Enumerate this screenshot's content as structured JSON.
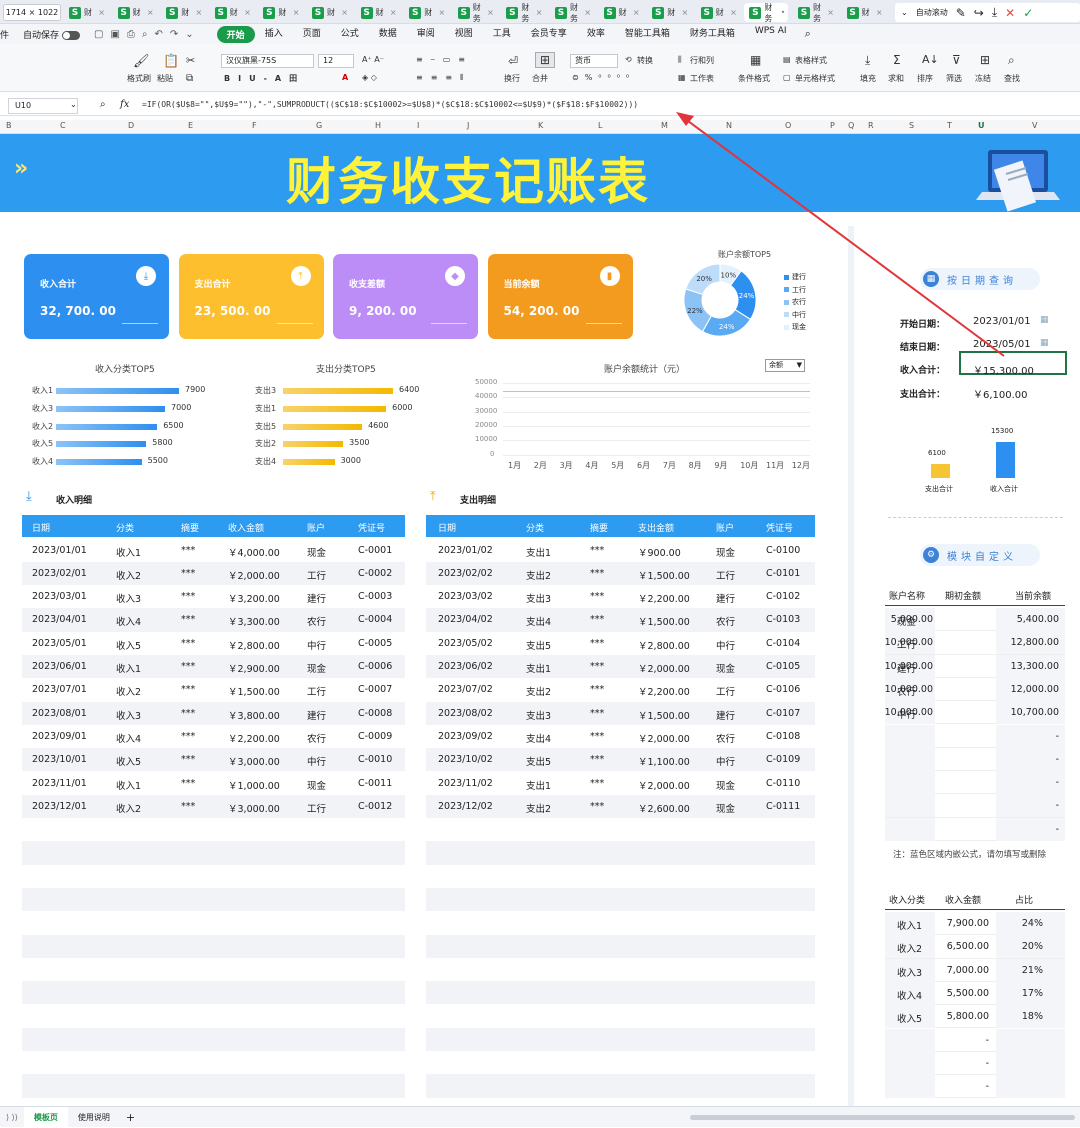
{
  "window": {
    "size_badge": "1714 × 1022",
    "tabs": [
      "财",
      "财",
      "财",
      "财",
      "财",
      "财",
      "财",
      "财",
      "财务",
      "财务",
      "财务",
      "财",
      "财",
      "财",
      "财务",
      "财务",
      "财"
    ],
    "topright": {
      "auto_scroll": "自动滚动"
    }
  },
  "menubar": {
    "file": "件",
    "autosave": "自动保存",
    "items": [
      "开始",
      "插入",
      "页面",
      "公式",
      "数据",
      "审阅",
      "视图",
      "工具",
      "会员专享",
      "效率",
      "智能工具箱",
      "财务工具箱",
      "WPS AI"
    ]
  },
  "ribbon": {
    "format_painter": "格式刷",
    "paste": "粘贴",
    "font_name": "汉仪旗黑-75S",
    "font_size": "12",
    "wrap": "换行",
    "merge": "合并",
    "number_format": "货币",
    "convert": "转换",
    "row_col": "行和列",
    "worksheet": "工作表",
    "cond_format": "条件格式",
    "table_style": "表格样式",
    "cell_style": "单元格样式",
    "fill": "填充",
    "sum": "求和",
    "sort": "排序",
    "filter": "筛选",
    "freeze": "冻结",
    "find": "查找"
  },
  "formula_bar": {
    "name_box": "U10",
    "fx": "fx",
    "formula": "=IF(OR($U$8=\"\",$U$9=\"\"),\"-\",SUMPRODUCT(($C$18:$C$10002>=$U$8)*($C$18:$C$10002<=$U$9)*($F$18:$F$10002)))"
  },
  "col_headers": [
    "B",
    "C",
    "D",
    "E",
    "F",
    "G",
    "H",
    "I",
    "J",
    "K",
    "L",
    "M",
    "N",
    "O",
    "P",
    "Q",
    "R",
    "S",
    "T",
    "U",
    "V"
  ],
  "banner": {
    "title": "财务收支记账表"
  },
  "cards": [
    {
      "title": "收入合计",
      "value": "32, 700. 00",
      "color": "#2d8ff0"
    },
    {
      "title": "支出合计",
      "value": "23, 500. 00",
      "color": "#fdbf2d"
    },
    {
      "title": "收支差额",
      "value": "9, 200. 00",
      "color": "#bc8df6"
    },
    {
      "title": "当前余额",
      "value": "54, 200. 00",
      "color": "#f29b1e"
    }
  ],
  "pie": {
    "title": "账户余额TOP5",
    "slices": [
      {
        "name": "建行",
        "pct": "24%",
        "value": 24,
        "color": "#2d8ff0"
      },
      {
        "name": "工行",
        "pct": "24%",
        "value": 24,
        "color": "#5aa9f3"
      },
      {
        "name": "农行",
        "pct": "22%",
        "value": 22,
        "color": "#8cc3f6"
      },
      {
        "name": "中行",
        "pct": "20%",
        "value": 20,
        "color": "#bcdcfa"
      },
      {
        "name": "现金",
        "pct": "10%",
        "value": 10,
        "color": "#e3f0fd"
      }
    ]
  },
  "income_top5": {
    "title": "收入分类TOP5",
    "items": [
      {
        "label": "收入1",
        "value": 7900
      },
      {
        "label": "收入3",
        "value": 7000
      },
      {
        "label": "收入2",
        "value": 6500
      },
      {
        "label": "收入5",
        "value": 5800
      },
      {
        "label": "收入4",
        "value": 5500
      }
    ]
  },
  "expense_top5": {
    "title": "支出分类TOP5",
    "items": [
      {
        "label": "支出3",
        "value": 6400
      },
      {
        "label": "支出1",
        "value": 6000
      },
      {
        "label": "支出5",
        "value": 4600
      },
      {
        "label": "支出2",
        "value": 3500
      },
      {
        "label": "支出4",
        "value": 3000
      }
    ]
  },
  "chart_data": [
    {
      "type": "bar",
      "title": "收入分类TOP5",
      "categories": [
        "收入1",
        "收入3",
        "收入2",
        "收入5",
        "收入4"
      ],
      "values": [
        7900,
        7000,
        6500,
        5800,
        5500
      ]
    },
    {
      "type": "bar",
      "title": "支出分类TOP5",
      "categories": [
        "支出3",
        "支出1",
        "支出5",
        "支出2",
        "支出4"
      ],
      "values": [
        6400,
        6000,
        4600,
        3500,
        3000
      ]
    },
    {
      "type": "pie",
      "title": "账户余额TOP5",
      "categories": [
        "建行",
        "工行",
        "农行",
        "中行",
        "现金"
      ],
      "values": [
        24,
        24,
        22,
        20,
        10
      ]
    },
    {
      "type": "line",
      "title": "账户余额统计（元）",
      "categories": [
        "1月",
        "2月",
        "3月",
        "4月",
        "5月",
        "6月",
        "7月",
        "8月",
        "9月",
        "10月",
        "11月",
        "12月"
      ],
      "ylim": [
        0,
        50000
      ],
      "yticks": [
        "50000",
        "40000",
        "30000",
        "20000",
        "10000",
        "0"
      ]
    },
    {
      "type": "bar",
      "categories": [
        "支出合计",
        "收入合计"
      ],
      "values": [
        6100,
        15300
      ]
    }
  ],
  "balance_chart": {
    "title": "账户余额统计（元）",
    "dropdown": "余额",
    "months": [
      "1月",
      "2月",
      "3月",
      "4月",
      "5月",
      "6月",
      "7月",
      "8月",
      "9月",
      "10月",
      "11月",
      "12月"
    ],
    "yticks": [
      "50000",
      "40000",
      "30000",
      "20000",
      "10000",
      "0"
    ]
  },
  "income_detail": {
    "title": "收入明细",
    "headers": [
      "日期",
      "分类",
      "摘要",
      "收入金额",
      "账户",
      "凭证号"
    ],
    "rows": [
      [
        "2023/01/01",
        "收入1",
        "***",
        "￥4,000.00",
        "现金",
        "C-0001"
      ],
      [
        "2023/02/01",
        "收入2",
        "***",
        "￥2,000.00",
        "工行",
        "C-0002"
      ],
      [
        "2023/03/01",
        "收入3",
        "***",
        "￥3,200.00",
        "建行",
        "C-0003"
      ],
      [
        "2023/04/01",
        "收入4",
        "***",
        "￥3,300.00",
        "农行",
        "C-0004"
      ],
      [
        "2023/05/01",
        "收入5",
        "***",
        "￥2,800.00",
        "中行",
        "C-0005"
      ],
      [
        "2023/06/01",
        "收入1",
        "***",
        "￥2,900.00",
        "现金",
        "C-0006"
      ],
      [
        "2023/07/01",
        "收入2",
        "***",
        "￥1,500.00",
        "工行",
        "C-0007"
      ],
      [
        "2023/08/01",
        "收入3",
        "***",
        "￥3,800.00",
        "建行",
        "C-0008"
      ],
      [
        "2023/09/01",
        "收入4",
        "***",
        "￥2,200.00",
        "农行",
        "C-0009"
      ],
      [
        "2023/10/01",
        "收入5",
        "***",
        "￥3,000.00",
        "中行",
        "C-0010"
      ],
      [
        "2023/11/01",
        "收入1",
        "***",
        "￥1,000.00",
        "现金",
        "C-0011"
      ],
      [
        "2023/12/01",
        "收入2",
        "***",
        "￥3,000.00",
        "工行",
        "C-0012"
      ]
    ]
  },
  "expense_detail": {
    "title": "支出明细",
    "headers": [
      "日期",
      "分类",
      "摘要",
      "支出金额",
      "账户",
      "凭证号"
    ],
    "rows": [
      [
        "2023/01/02",
        "支出1",
        "***",
        "￥900.00",
        "现金",
        "C-0100"
      ],
      [
        "2023/02/02",
        "支出2",
        "***",
        "￥1,500.00",
        "工行",
        "C-0101"
      ],
      [
        "2023/03/02",
        "支出3",
        "***",
        "￥2,200.00",
        "建行",
        "C-0102"
      ],
      [
        "2023/04/02",
        "支出4",
        "***",
        "￥1,500.00",
        "农行",
        "C-0103"
      ],
      [
        "2023/05/02",
        "支出5",
        "***",
        "￥2,800.00",
        "中行",
        "C-0104"
      ],
      [
        "2023/06/02",
        "支出1",
        "***",
        "￥2,000.00",
        "现金",
        "C-0105"
      ],
      [
        "2023/07/02",
        "支出2",
        "***",
        "￥2,200.00",
        "工行",
        "C-0106"
      ],
      [
        "2023/08/02",
        "支出3",
        "***",
        "￥1,500.00",
        "建行",
        "C-0107"
      ],
      [
        "2023/09/02",
        "支出4",
        "***",
        "￥2,000.00",
        "农行",
        "C-0108"
      ],
      [
        "2023/10/02",
        "支出5",
        "***",
        "￥1,100.00",
        "中行",
        "C-0109"
      ],
      [
        "2023/11/02",
        "支出1",
        "***",
        "￥2,000.00",
        "现金",
        "C-0110"
      ],
      [
        "2023/12/02",
        "支出2",
        "***",
        "￥2,600.00",
        "现金",
        "C-0111"
      ]
    ]
  },
  "date_query": {
    "title": "按日期查询",
    "start_label": "开始日期：",
    "start_value": "2023/01/01",
    "end_label": "结束日期：",
    "end_value": "2023/05/01",
    "income_label": "收入合计：",
    "income_value": "￥15,300.00",
    "expense_label": "支出合计：",
    "expense_value": "￥6,100.00",
    "bars": [
      {
        "label": "支出合计",
        "value": 6100,
        "text": "6100",
        "color": "#f6c533"
      },
      {
        "label": "收入合计",
        "value": 15300,
        "text": "15300",
        "color": "#2d8ff0"
      }
    ]
  },
  "custom_module": {
    "title": "模块自定义",
    "headers": [
      "账户名称",
      "期初金额",
      "当前余额"
    ],
    "rows": [
      [
        "现金",
        "5,000.00",
        "5,400.00"
      ],
      [
        "工行",
        "10,000.00",
        "12,800.00"
      ],
      [
        "建行",
        "10,000.00",
        "13,300.00"
      ],
      [
        "农行",
        "10,000.00",
        "12,000.00"
      ],
      [
        "中行",
        "10,000.00",
        "10,700.00"
      ],
      [
        "",
        "",
        "-"
      ],
      [
        "",
        "",
        "-"
      ],
      [
        "",
        "",
        "-"
      ],
      [
        "",
        "",
        "-"
      ],
      [
        "",
        "",
        "-"
      ]
    ],
    "note": "注：蓝色区域内嵌公式，请勿填写或删除"
  },
  "income_category": {
    "headers": [
      "收入分类",
      "收入金额",
      "占比"
    ],
    "rows": [
      [
        "收入1",
        "7,900.00",
        "24%"
      ],
      [
        "收入2",
        "6,500.00",
        "20%"
      ],
      [
        "收入3",
        "7,000.00",
        "21%"
      ],
      [
        "收入4",
        "5,500.00",
        "17%"
      ],
      [
        "收入5",
        "5,800.00",
        "18%"
      ],
      [
        "",
        "-",
        ""
      ],
      [
        "",
        "-",
        ""
      ],
      [
        "",
        "-",
        ""
      ]
    ]
  },
  "sheets": [
    "模板页",
    "使用说明"
  ]
}
